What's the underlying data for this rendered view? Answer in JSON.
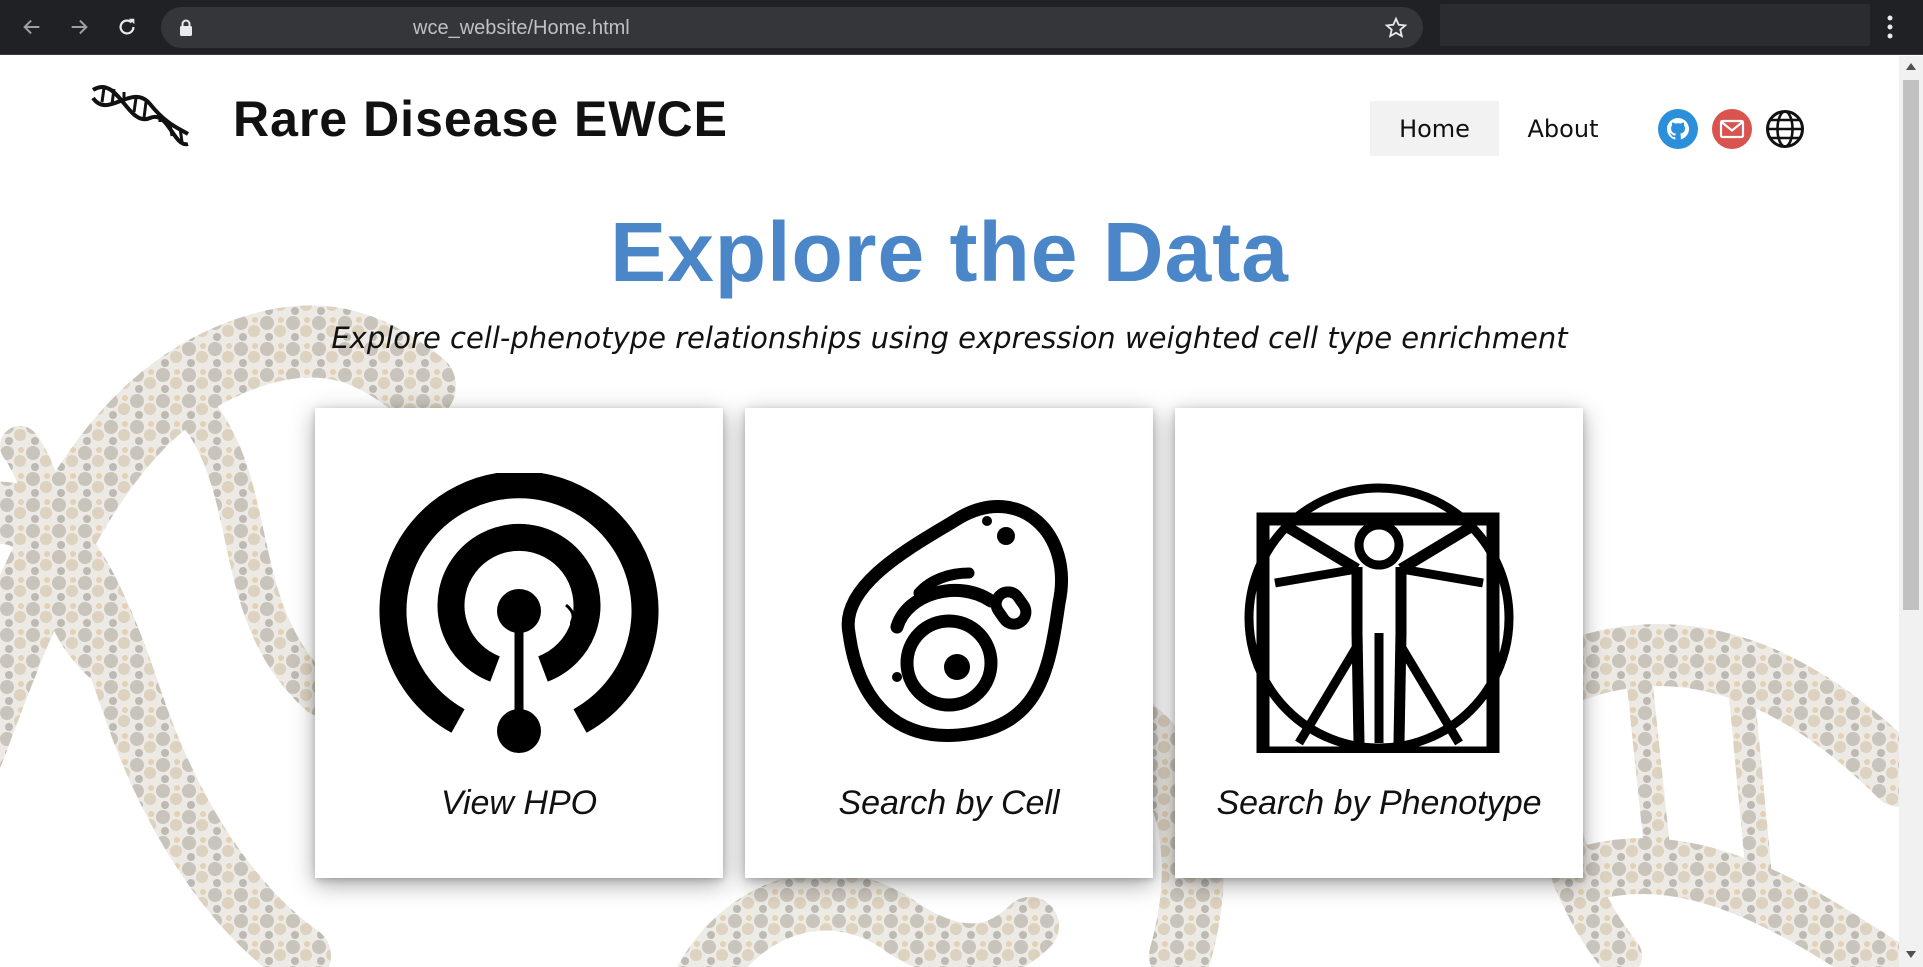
{
  "browser": {
    "url": "wce_website/Home.html",
    "icons": [
      "back-arrow-icon",
      "forward-arrow-icon",
      "reload-icon",
      "lock-icon",
      "bookmark-star-icon",
      "menu-dots-icon"
    ]
  },
  "site": {
    "title": "Rare Disease EWCE"
  },
  "nav": {
    "home_label": "Home",
    "about_label": "About",
    "social_icons": [
      "github-icon",
      "email-icon",
      "globe-icon"
    ]
  },
  "hero": {
    "title": "Explore the Data",
    "subtitle": "Explore cell-phenotype relationships using expression weighted cell type enrichment"
  },
  "cards": [
    {
      "label": "View HPO",
      "icon": "hpo-logo-icon"
    },
    {
      "label": "Search by Cell",
      "icon": "cell-icon"
    },
    {
      "label": "Search by Phenotype",
      "icon": "vitruvian-man-icon"
    }
  ],
  "colors": {
    "accent": "#4a86c8",
    "chrome_bg": "#202124",
    "github_blue": "#2c8fd9",
    "email_red": "#d9534f"
  }
}
